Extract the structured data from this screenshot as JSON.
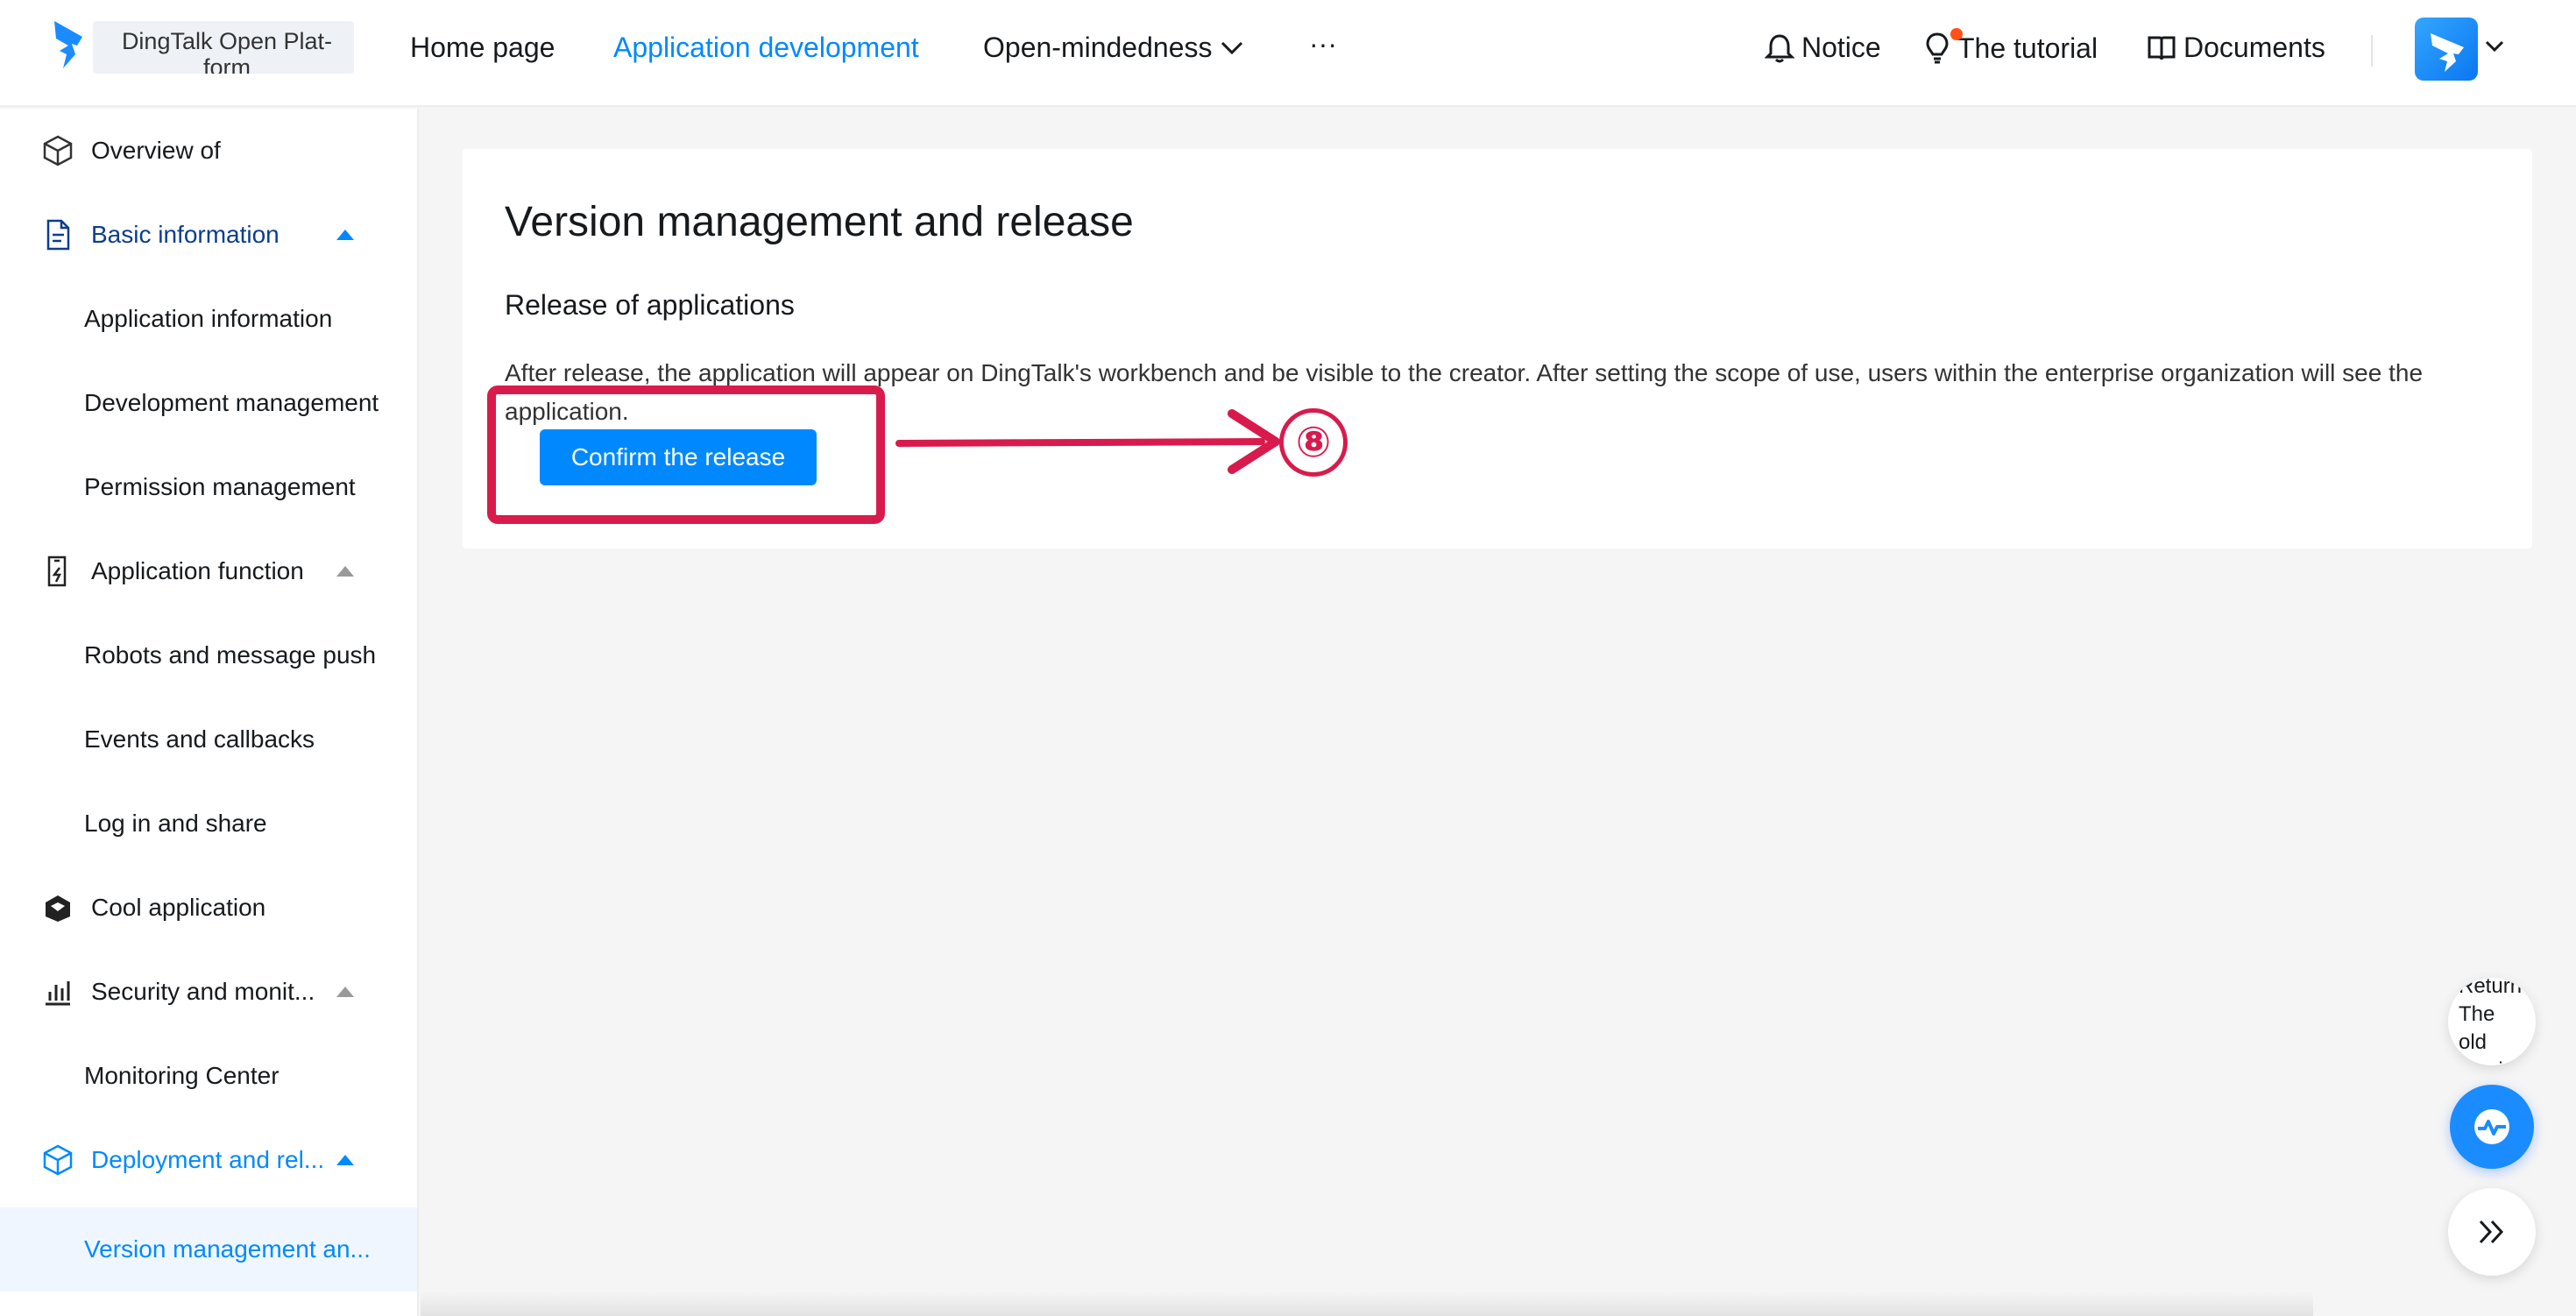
{
  "header": {
    "logo_text": "DingTalk Open Plat-form",
    "nav": [
      {
        "label": "Home page"
      },
      {
        "label": "Application development",
        "active": true
      },
      {
        "label": "Open-mindedness"
      },
      {
        "label": "···"
      }
    ],
    "links": {
      "notice": "Notice",
      "tutorial": "The tutorial",
      "documents": "Documents"
    }
  },
  "sidebar": {
    "items": [
      {
        "label": "Overview of",
        "icon": "cube-outline-icon"
      },
      {
        "label": "Basic information",
        "icon": "document-icon"
      },
      {
        "label": "Application information"
      },
      {
        "label": "Development management"
      },
      {
        "label": "Permission management"
      },
      {
        "label": "Application function",
        "icon": "phone-bolt-icon"
      },
      {
        "label": "Robots and message push"
      },
      {
        "label": "Events and callbacks"
      },
      {
        "label": "Log in and share"
      },
      {
        "label": "Cool application",
        "icon": "cool-app-icon"
      },
      {
        "label": "Security and monit...",
        "icon": "bar-chart-icon"
      },
      {
        "label": "Monitoring Center"
      },
      {
        "label": "Deployment and rel...",
        "icon": "cube-icon"
      },
      {
        "label": "Version management an..."
      }
    ]
  },
  "main": {
    "title": "Version management and release",
    "subtitle": "Release of applications",
    "description": "After release, the application will appear on DingTalk's workbench and be visible to the creator. After setting the scope of use, users within the enterprise organization will see the application.",
    "confirm_button": "Confirm the release"
  },
  "annotation": {
    "step_number": "⑧",
    "color": "#d81b4c"
  },
  "floating": {
    "old_version": "Return The old version"
  },
  "colors": {
    "accent": "#0089ff",
    "selected_bg": "#eff6ff"
  }
}
